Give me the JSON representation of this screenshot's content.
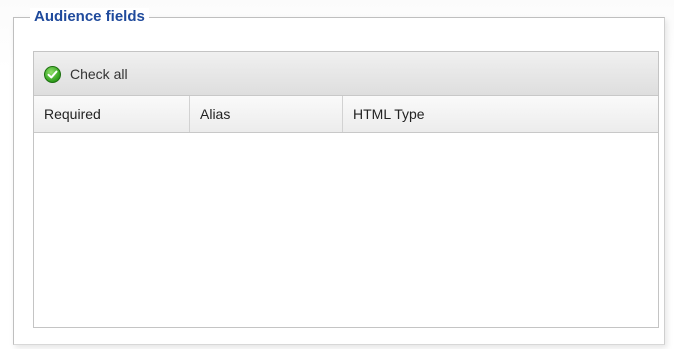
{
  "fieldset": {
    "legend": "Audience fields"
  },
  "toolbar": {
    "check_all_label": "Check all",
    "check_all_icon": "check-circle-icon",
    "check_all_color": "#2f9e1c"
  },
  "grid": {
    "columns": [
      "Required",
      "Alias",
      "HTML Type"
    ],
    "rows": []
  },
  "colors": {
    "legend": "#1f4a9c",
    "border": "#c4c4c4",
    "toolbar_bg": "#e6e6e6"
  }
}
